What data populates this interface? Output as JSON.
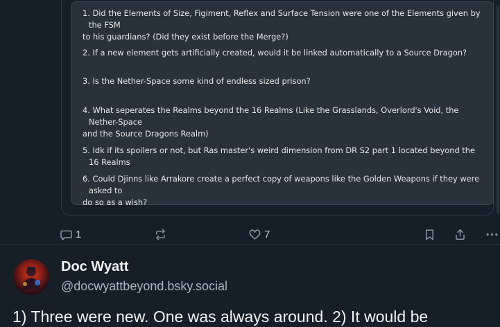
{
  "question_list": [
    {
      "line1": "1. Did the Elements of Size, Figiment, Reflex and Surface Tension were one of the Elements given by the FSM",
      "line2": "to his guardians?  (Did they exist before the Merge?)"
    },
    {
      "line1": "2. If a new element gets artificially created, would it be linked automatically to a Source Dragon?",
      "line2": ""
    },
    {
      "line1": "3. Is the Nether-Space some kind of endless sized prison?",
      "line2": ""
    },
    {
      "line1": "4. What seperates the Realms beyond the 16 Realms (Like the Grasslands, Overlord's Void, the Nether-Space",
      "line2": "and the Source Dragons Realm)"
    },
    {
      "line1": "5. Idk if its spoilers or not, but Ras master's weird dimension from DR S2 part 1 located beyond the 16 Realms",
      "line2": ""
    },
    {
      "line1": "6. Could Djinns like Arrakore create a perfect copy of weapons like the Golden Weapons if they were asked to",
      "line2": "do so as a wish?"
    }
  ],
  "actions": {
    "reply_icon": "reply-icon",
    "reply_count": "1",
    "repost_icon": "repost-icon",
    "like_icon": "heart-icon",
    "like_count": "7",
    "bookmark_icon": "bookmark-icon",
    "share_icon": "share-icon",
    "more_icon": "more-icon"
  },
  "reply_post": {
    "display_name": "Doc Wyatt",
    "handle": "@docwyattbeyond.bsky.social",
    "text": "1) Three were new. One was always around. 2) It would be"
  },
  "colors": {
    "background": "#161e27",
    "list_box": "#29313b",
    "icon": "#8b98a5",
    "handle": "#aab6c1"
  }
}
